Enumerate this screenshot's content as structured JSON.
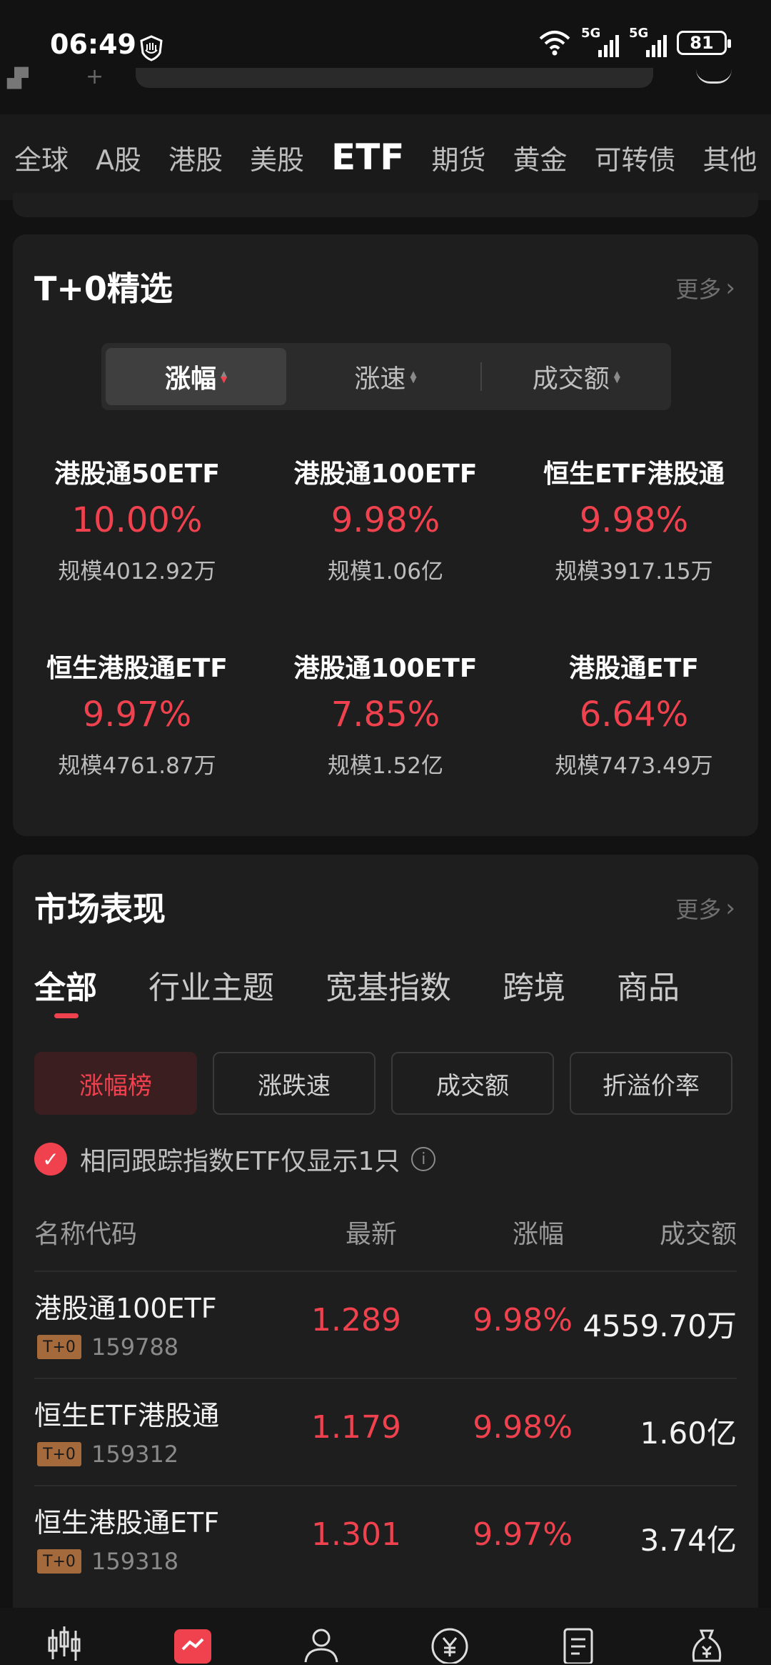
{
  "status": {
    "time": "06:49",
    "net1": "5G",
    "net2": "5G",
    "battery": "81"
  },
  "market_tabs": [
    "全球",
    "A股",
    "港股",
    "美股",
    "ETF",
    "期货",
    "黄金",
    "可转债",
    "其他"
  ],
  "active_market_tab": "ETF",
  "t0": {
    "title": "T+0精选",
    "more": "更多",
    "segments": [
      "涨幅",
      "涨速",
      "成交额"
    ],
    "items": [
      {
        "name": "港股通50ETF",
        "pct": "10.00%",
        "scale": "规模4012.92万"
      },
      {
        "name": "港股通100ETF",
        "pct": "9.98%",
        "scale": "规模1.06亿"
      },
      {
        "name": "恒生ETF港股通",
        "pct": "9.98%",
        "scale": "规模3917.15万"
      },
      {
        "name": "恒生港股通ETF",
        "pct": "9.97%",
        "scale": "规模4761.87万"
      },
      {
        "name": "港股通100ETF",
        "pct": "7.85%",
        "scale": "规模1.52亿"
      },
      {
        "name": "港股通ETF",
        "pct": "6.64%",
        "scale": "规模7473.49万"
      }
    ]
  },
  "market": {
    "title": "市场表现",
    "more": "更多",
    "tabs": [
      "全部",
      "行业主题",
      "宽基指数",
      "跨境",
      "商品"
    ],
    "filters": [
      "涨幅榜",
      "涨跌速",
      "成交额",
      "折溢价率"
    ],
    "dedupe_label": "相同跟踪指数ETF仅显示1只",
    "columns": [
      "名称代码",
      "最新",
      "涨幅",
      "成交额"
    ],
    "rows": [
      {
        "name": "港股通100ETF",
        "badge": "T+0",
        "code": "159788",
        "last": "1.289",
        "pct": "9.98%",
        "amount": "4559.70万"
      },
      {
        "name": "恒生ETF港股通",
        "badge": "T+0",
        "code": "159312",
        "last": "1.179",
        "pct": "9.98%",
        "amount": "1.60亿"
      },
      {
        "name": "恒生港股通ETF",
        "badge": "T+0",
        "code": "159318",
        "last": "1.301",
        "pct": "9.97%",
        "amount": "3.74亿"
      }
    ]
  },
  "colors": {
    "up": "#f0424e",
    "bg": "#121212",
    "card": "#1e1e1e"
  }
}
